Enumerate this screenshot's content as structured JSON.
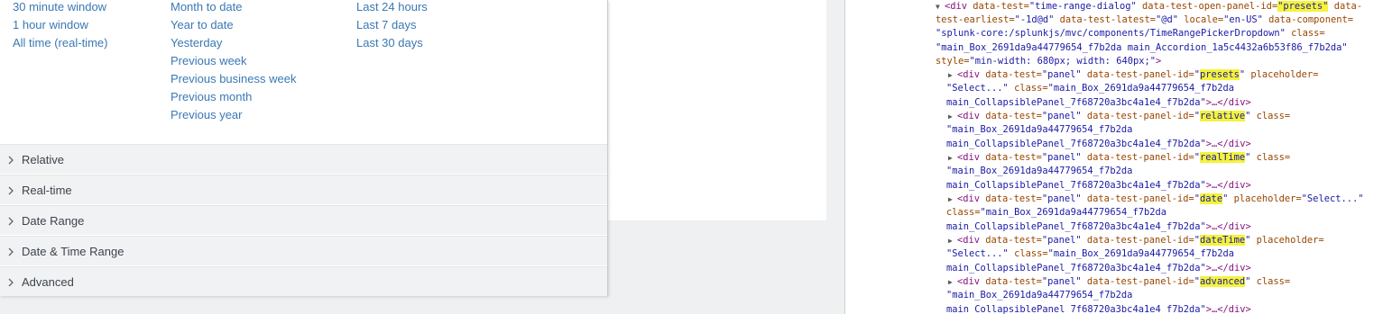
{
  "presets": {
    "column1": [
      "30 minute window",
      "1 hour window",
      "All time (real-time)"
    ],
    "column2": [
      "Month to date",
      "Year to date",
      "Yesterday",
      "Previous week",
      "Previous business week",
      "Previous month",
      "Previous year"
    ],
    "column3": [
      "Last 24 hours",
      "Last 7 days",
      "Last 30 days"
    ]
  },
  "panels": [
    "Relative",
    "Real-time",
    "Date Range",
    "Date & Time Range",
    "Advanced"
  ],
  "devtools": {
    "line1": {
      "tag_open": "<div",
      "a1_name": " data-test=",
      "a1_value": "\"time-range-dialog\"",
      "a2_name": " data-test-open-panel-id=",
      "a2_value": "\"presets\"",
      "a3_name": " data-"
    },
    "line2": {
      "a3_name_cont": "test-earliest=",
      "a3_value": "\"-1d@d\"",
      "a4_name": " data-test-latest=",
      "a4_value": "\"@d\"",
      "a5_name": " locale=",
      "a5_value": "\"en-US\"",
      "a6_name": " data-component="
    },
    "line3": {
      "a6_value": "\"splunk-core:/splunkjs/mvc/components/TimeRangePickerDropdown\"",
      "a7_name": " class="
    },
    "line4": {
      "a7_value": "\"main_Box_2691da9a44779654_f7b2da main_Accordion_1a5c4432a6b53f86_f7b2da\""
    },
    "line5": {
      "a8_name": "style=",
      "a8_value": "\"min-width: 680px; width: 640px;\"",
      "close": ">"
    },
    "panels": [
      {
        "tag": "<div",
        "dt": " data-test=",
        "dt_v": "\"panel\"",
        "pid": " data-test-panel-id=",
        "q1": "\"",
        "id": "presets",
        "q2": "\"",
        "ph": " placeholder=",
        "ph_v_a": "",
        "tail1": "",
        "l2_start": "\"Select...\"",
        "l2_cls": " class=",
        "l2_val": "\"main_Box_2691da9a44779654_f7b2da",
        "l3_val": "main_CollapsiblePanel_7f68720a3bc4a1e4_f7b2da\"",
        "l3_end": ">…</div>"
      },
      {
        "tag": "<div",
        "dt": " data-test=",
        "dt_v": "\"panel\"",
        "pid": " data-test-panel-id=",
        "q1": "\"",
        "id": "relative",
        "q2": "\"",
        "ph": " class=",
        "ph_v_a": "",
        "tail1": "",
        "l2_start": "",
        "l2_cls": "",
        "l2_val": "\"main_Box_2691da9a44779654_f7b2da",
        "l3_val": "main_CollapsiblePanel_7f68720a3bc4a1e4_f7b2da\"",
        "l3_end": ">…</div>"
      },
      {
        "tag": "<div",
        "dt": " data-test=",
        "dt_v": "\"panel\"",
        "pid": " data-test-panel-id=",
        "q1": "\"",
        "id": "realTime",
        "q2": "\"",
        "ph": " class=",
        "ph_v_a": "",
        "tail1": "",
        "l2_start": "",
        "l2_cls": "",
        "l2_val": "\"main_Box_2691da9a44779654_f7b2da",
        "l3_val": "main_CollapsiblePanel_7f68720a3bc4a1e4_f7b2da\"",
        "l3_end": ">…</div>"
      },
      {
        "tag": "<div",
        "dt": " data-test=",
        "dt_v": "\"panel\"",
        "pid": " data-test-panel-id=",
        "q1": "\"",
        "id": "date",
        "q2": "\"",
        "ph": " placeholder=",
        "ph_v_a": "\"Select...\"",
        "tail1": "",
        "l2_start": "",
        "l2_cls": "class=",
        "l2_val": "\"main_Box_2691da9a44779654_f7b2da",
        "l3_val": "main_CollapsiblePanel_7f68720a3bc4a1e4_f7b2da\"",
        "l3_end": ">…</div>"
      },
      {
        "tag": "<div",
        "dt": " data-test=",
        "dt_v": "\"panel\"",
        "pid": " data-test-panel-id=",
        "q1": "\"",
        "id": "dateTime",
        "q2": "\"",
        "ph": " placeholder=",
        "ph_v_a": "",
        "tail1": "",
        "l2_start": "\"Select...\"",
        "l2_cls": " class=",
        "l2_val": "\"main_Box_2691da9a44779654_f7b2da",
        "l3_val": "main_CollapsiblePanel_7f68720a3bc4a1e4_f7b2da\"",
        "l3_end": ">…</div>"
      },
      {
        "tag": "<div",
        "dt": " data-test=",
        "dt_v": "\"panel\"",
        "pid": " data-test-panel-id=",
        "q1": "\"",
        "id": "advanced",
        "q2": "\"",
        "ph": " class=",
        "ph_v_a": "",
        "tail1": "",
        "l2_start": "",
        "l2_cls": "",
        "l2_val": "\"main_Box_2691da9a44779654_f7b2da",
        "l3_val": "main_CollapsiblePanel_7f68720a3bc4a1e4_f7b2da\"",
        "l3_end": ">…</div>"
      }
    ]
  },
  "colors": {
    "link": "#3a78b5",
    "panel_bg": "#f1f2f3",
    "highlight": "#f5f33a",
    "tag": "#881280",
    "attr_name": "#994500",
    "attr_value": "#1a1aa6"
  },
  "icons": {
    "panel_chevron": "chevron-right-icon",
    "expand_triangle": "triangle-right-icon",
    "collapse_triangle": "triangle-down-icon"
  }
}
